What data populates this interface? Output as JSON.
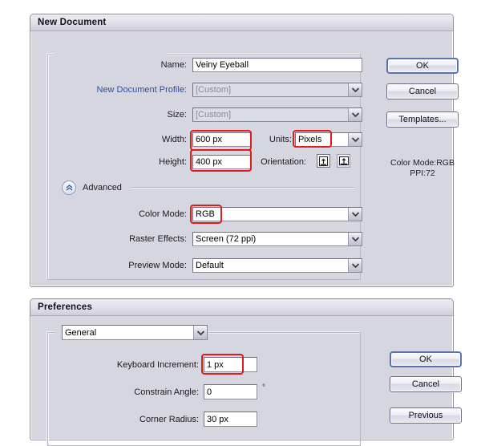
{
  "new_document": {
    "title": "New Document",
    "fields": {
      "name_label": "Name:",
      "name_value": "Veiny Eyeball",
      "profile_label": "New Document Profile:",
      "profile_value": "[Custom]",
      "size_label": "Size:",
      "size_value": "[Custom]",
      "width_label": "Width:",
      "width_value": "600 px",
      "height_label": "Height:",
      "height_value": "400 px",
      "units_label": "Units:",
      "units_value": "Pixels",
      "orientation_label": "Orientation:",
      "advanced_label": "Advanced",
      "color_mode_label": "Color Mode:",
      "color_mode_value": "RGB",
      "raster_effects_label": "Raster Effects:",
      "raster_effects_value": "Screen (72 ppi)",
      "preview_mode_label": "Preview Mode:",
      "preview_mode_value": "Default"
    },
    "buttons": {
      "ok": "OK",
      "cancel": "Cancel",
      "templates": "Templates..."
    },
    "info": {
      "color_mode": "Color Mode:RGB",
      "ppi": "PPI:72"
    }
  },
  "preferences": {
    "title": "Preferences",
    "category_value": "General",
    "fields": {
      "keyboard_increment_label": "Keyboard Increment:",
      "keyboard_increment_value": "1 px",
      "constrain_angle_label": "Constrain Angle:",
      "constrain_angle_value": "0",
      "degree_symbol": "°",
      "corner_radius_label": "Corner Radius:",
      "corner_radius_value": "30 px"
    },
    "buttons": {
      "ok": "OK",
      "cancel": "Cancel",
      "previous": "Previous"
    }
  },
  "annotations": {
    "highlight_color": "#e01b1b"
  }
}
